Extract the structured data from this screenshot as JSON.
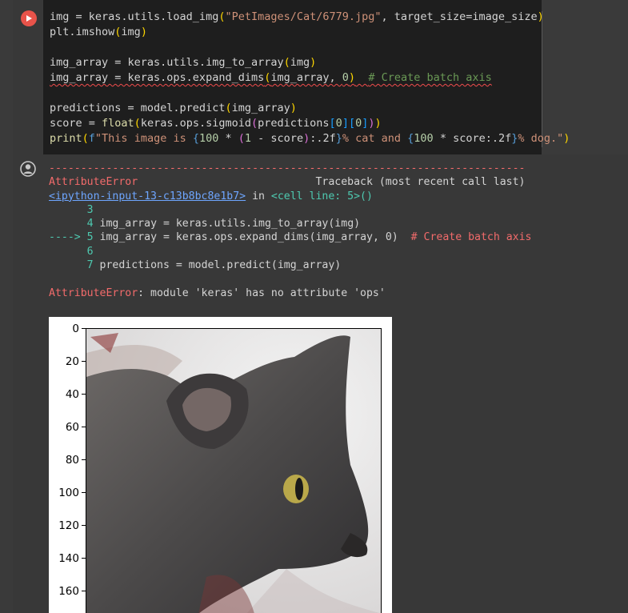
{
  "cell": {
    "run_button": "run-cell",
    "code_lines": [
      "img = keras.utils.load_img(\"PetImages/Cat/6779.jpg\", target_size=image_size)",
      "plt.imshow(img)",
      "",
      "img_array = keras.utils.img_to_array(img)",
      "img_array = keras.ops.expand_dims(img_array, 0)  # Create batch axis",
      "",
      "predictions = model.predict(img_array)",
      "score = float(keras.ops.sigmoid(predictions[0][0]))",
      "print(f\"This image is {100 * (1 - score):.2f}% cat and {100 * score:.2f}% dog.\")"
    ]
  },
  "output": {
    "dashes": "---------------------------------------------------------------------------",
    "error_name": "AttributeError",
    "traceback_label": "Traceback (most recent call last)",
    "input_link": "<ipython-input-13-c13b8bc8e1b7>",
    "in_text": " in ",
    "cell_line": "<cell line: 5>()",
    "trace_lines": [
      {
        "num": "3",
        "arrow": "",
        "code": ""
      },
      {
        "num": "4",
        "arrow": "",
        "code": "img_array = keras.utils.img_to_array(img)"
      },
      {
        "num": "5",
        "arrow": "---->",
        "code": "img_array = keras.ops.expand_dims(img_array, 0)",
        "comment": "# Create batch axis"
      },
      {
        "num": "6",
        "arrow": "",
        "code": ""
      },
      {
        "num": "7",
        "arrow": "",
        "code": "predictions = model.predict(img_array)"
      }
    ],
    "error_message": ": module 'keras' has no attribute 'ops'"
  },
  "plot": {
    "y_ticks": [
      "0",
      "20",
      "40",
      "60",
      "80",
      "100",
      "120",
      "140",
      "160"
    ]
  },
  "colors": {
    "run_button": "#e8534a",
    "error": "#f26b6b",
    "link": "#6ea6ff"
  }
}
